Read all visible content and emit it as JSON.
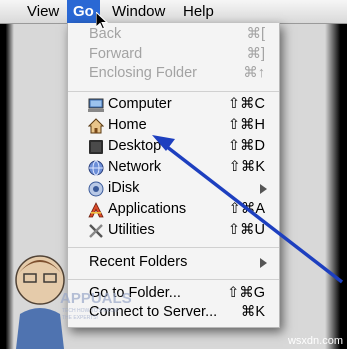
{
  "menubar": {
    "view": "View",
    "go": "Go",
    "window": "Window",
    "help": "Help"
  },
  "go_menu": {
    "back": {
      "label": "Back",
      "shortcut": "⌘["
    },
    "forward": {
      "label": "Forward",
      "shortcut": "⌘]"
    },
    "enclosing": {
      "label": "Enclosing Folder",
      "shortcut": "⌘↑"
    },
    "computer": {
      "label": "Computer",
      "shortcut": "⇧⌘C",
      "icon": "computer-icon"
    },
    "home": {
      "label": "Home",
      "shortcut": "⇧⌘H",
      "icon": "home-icon"
    },
    "desktop": {
      "label": "Desktop",
      "shortcut": "⇧⌘D",
      "icon": "desktop-icon"
    },
    "network": {
      "label": "Network",
      "shortcut": "⇧⌘K",
      "icon": "network-globe-icon"
    },
    "idisk": {
      "label": "iDisk",
      "icon": "idisk-icon"
    },
    "applications": {
      "label": "Applications",
      "shortcut": "⇧⌘A",
      "icon": "applications-icon"
    },
    "utilities": {
      "label": "Utilities",
      "shortcut": "⇧⌘U",
      "icon": "utilities-icon"
    },
    "recent": {
      "label": "Recent Folders"
    },
    "goto": {
      "label": "Go to Folder...",
      "shortcut": "⇧⌘G"
    },
    "connect": {
      "label": "Connect to Server...",
      "shortcut": "⌘K"
    }
  },
  "watermark": {
    "brand": "APPUALS",
    "tagline": "TECH HOW-TO'S FROM THE EXPERTS!"
  },
  "credit": "wsxdn.com",
  "colors": {
    "menu_highlight": "#2a68d4",
    "annotation_arrow": "#1d3fbf",
    "disabled_text": "#a3a3a3"
  }
}
